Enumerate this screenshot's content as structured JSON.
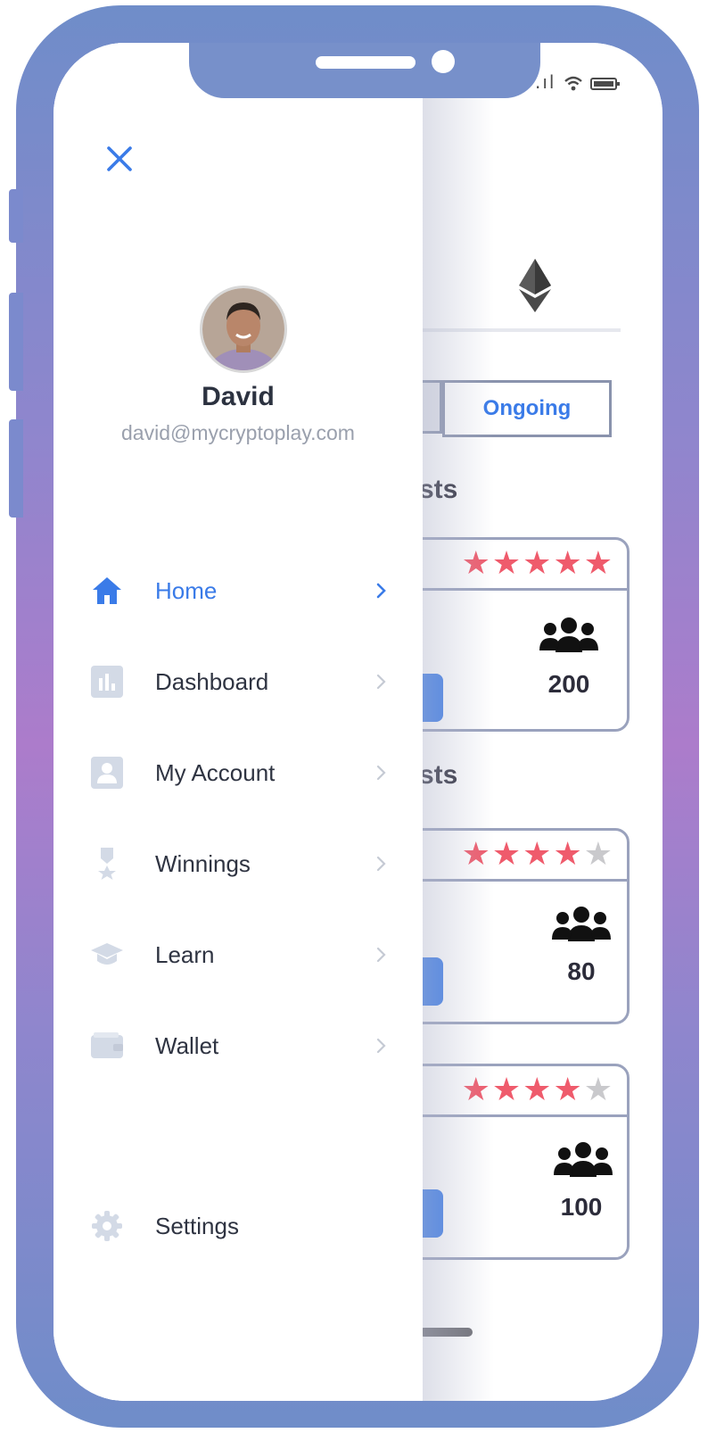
{
  "status_bar": {
    "signal": ".ıl",
    "wifi": "wifi-icon",
    "battery": "battery-icon"
  },
  "drawer": {
    "close_icon": "close-icon",
    "user": {
      "name": "David",
      "email": "david@mycryptoplay.com"
    },
    "menu": [
      {
        "label": "Home",
        "icon": "home-icon",
        "active": true
      },
      {
        "label": "Dashboard",
        "icon": "chart-icon",
        "active": false
      },
      {
        "label": "My Account",
        "icon": "account-icon",
        "active": false
      },
      {
        "label": "Winnings",
        "icon": "medal-icon",
        "active": false
      },
      {
        "label": "Learn",
        "icon": "graduation-cap-icon",
        "active": false
      },
      {
        "label": "Wallet",
        "icon": "wallet-icon",
        "active": false
      }
    ],
    "settings": {
      "label": "Settings",
      "icon": "gear-icon"
    }
  },
  "background": {
    "tab_ongoing": "Ongoing",
    "section_heads": [
      "sts",
      "sts"
    ],
    "cards": [
      {
        "stars": 5,
        "players": "200"
      },
      {
        "stars": 4,
        "players": "80"
      },
      {
        "stars": 4,
        "players": "100"
      }
    ]
  },
  "colors": {
    "accent": "#3a7be8",
    "star": "#ef5b6c",
    "frame": "#7790ca"
  }
}
